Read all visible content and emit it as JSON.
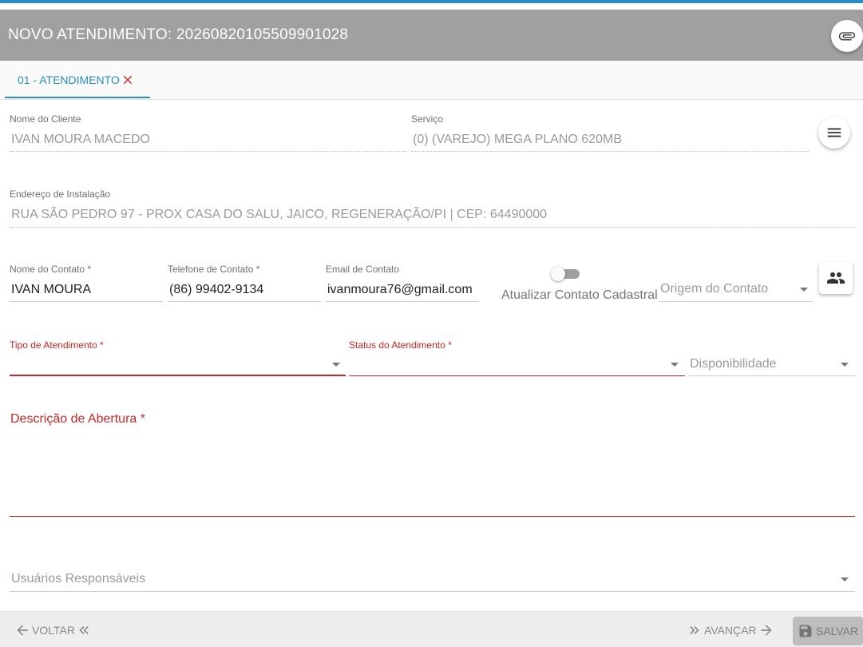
{
  "header": {
    "title": "NOVO ATENDIMENTO: 2026082010550990 1028",
    "attach_icon": "paperclip-icon"
  },
  "tabs": [
    {
      "label": "01 - ATENDIMENTO",
      "close_icon": "close-icon"
    }
  ],
  "form": {
    "cliente": {
      "label": "Nome do Cliente",
      "value": "IVAN MOURA MACEDO"
    },
    "servico": {
      "label": "Serviço",
      "value": "(0) (VAREJO) MEGA PLANO 620MB"
    },
    "menu_icon": "menu-icon",
    "endereco": {
      "label": "Endereço de Instalação",
      "value": "RUA SÃO PEDRO 97 - PROX CASA DO SALU, JAICO, REGENERAÇÃO/PI | CEP: 64490000"
    },
    "nome_contato": {
      "label": "Nome do Contato",
      "required_mark": "*",
      "value": "IVAN MOURA"
    },
    "telefone_contato": {
      "label": "Telefone de Contato",
      "required_mark": "*",
      "value": "(86) 99402-9134"
    },
    "email_contato": {
      "label": "Email de Contato",
      "value": "ivanmoura76@gmail.com"
    },
    "atualizar_contato": {
      "label": "Atualizar Contato Cadastral",
      "checked": false
    },
    "origem_contato": {
      "placeholder": "Origem do Contato"
    },
    "contacts_icon": "people-icon",
    "tipo_atendimento": {
      "label": "Tipo de Atendimento",
      "required_mark": "*",
      "value": ""
    },
    "status_atendimento": {
      "label": "Status do Atendimento",
      "required_mark": "*",
      "value": ""
    },
    "disponibilidade": {
      "placeholder": "Disponibilidade"
    },
    "descricao_abertura": {
      "label": "Descrição de Abertura",
      "required_mark": "*",
      "value": ""
    },
    "usuarios_responsaveis": {
      "placeholder": "Usuários Responsáveis"
    }
  },
  "footer": {
    "voltar": "VOLTAR",
    "avancar": "AVANÇAR",
    "salvar": "SALVAR"
  },
  "colors": {
    "accent": "#2a8ec1",
    "header_bg": "#a0a0a0",
    "required": "#c62828"
  }
}
